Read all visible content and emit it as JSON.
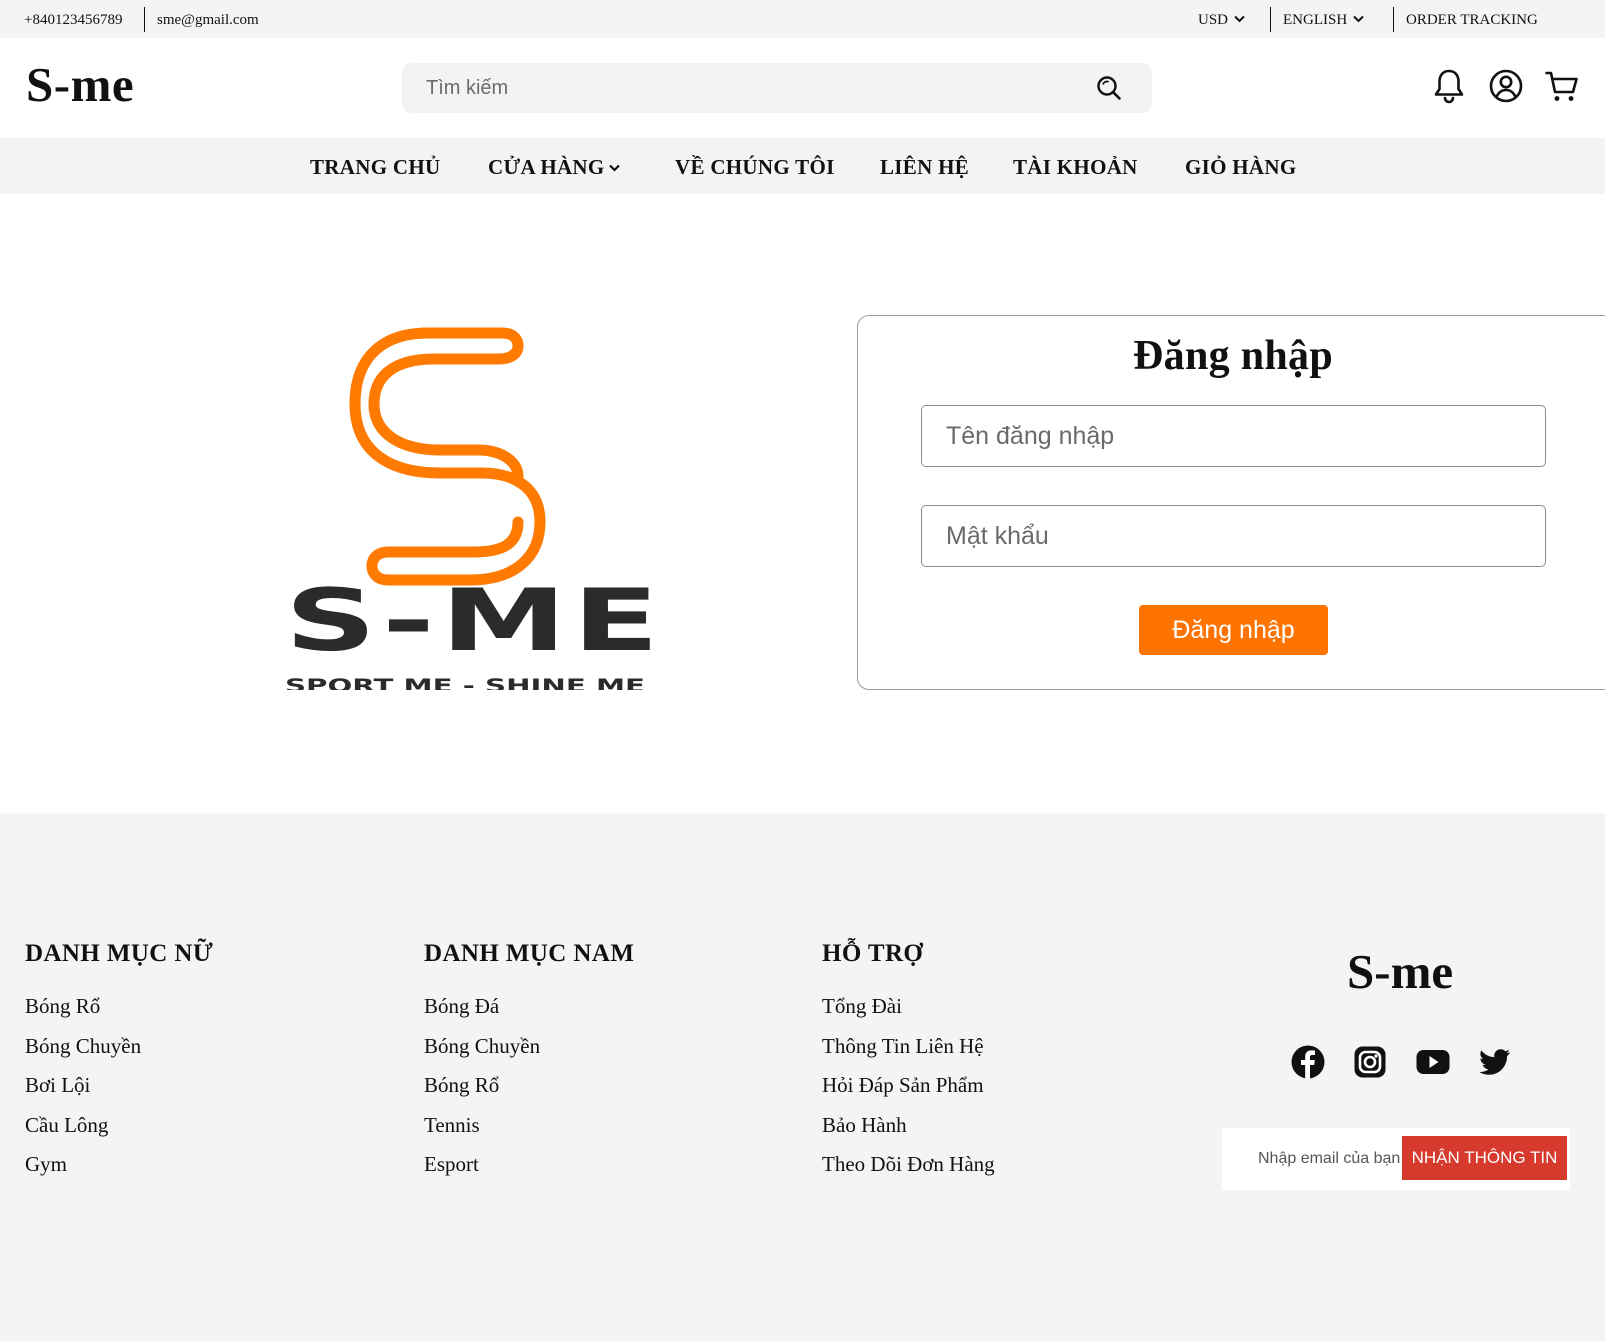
{
  "topbar": {
    "phone": "+840123456789",
    "email": "sme@gmail.com",
    "currency": "USD",
    "language": "ENGLISH",
    "order_tracking": "ORDER TRACKING"
  },
  "header": {
    "brand": "S-me",
    "search_placeholder": "Tìm kiếm",
    "icons": [
      "bell-icon",
      "user-icon",
      "cart-icon"
    ]
  },
  "nav": {
    "items": [
      "TRANG CHỦ",
      "CỬA HÀNG",
      "VỀ CHÚNG TÔI",
      "LIÊN HỆ",
      "TÀI KHOẢN",
      "GIỎ HÀNG"
    ]
  },
  "logo": {
    "wordmark": "S-ME",
    "tagline": "SPORT ME - SHINE ME",
    "accent_color": "#ff7a00"
  },
  "login": {
    "title": "Đăng nhập",
    "username_placeholder": "Tên đăng nhập",
    "password_placeholder": "Mật khẩu",
    "submit_label": "Đăng nhập",
    "button_color": "#ff7300"
  },
  "footer": {
    "women": {
      "title": "DANH MỤC NỮ",
      "items": [
        "Bóng Rổ",
        "Bóng Chuyền",
        "Bơi Lội",
        "Cầu Lông",
        "Gym"
      ]
    },
    "men": {
      "title": "DANH MỤC NAM",
      "items": [
        "Bóng Đá",
        "Bóng Chuyền",
        "Bóng Rổ",
        "Tennis",
        "Esport"
      ]
    },
    "support": {
      "title": "HỖ TRỢ",
      "items": [
        "Tổng Đài",
        "Thông Tin Liên Hệ",
        "Hỏi Đáp Sản Phẩm",
        "Bảo Hành",
        "Theo Dõi Đơn Hàng"
      ]
    },
    "brand": "S-me",
    "socials": [
      "facebook-icon",
      "instagram-icon",
      "youtube-icon",
      "twitter-icon"
    ],
    "newsletter_placeholder": "Nhập email của bạn",
    "newsletter_button": "NHẬN THÔNG TIN",
    "newsletter_button_color": "#d53a2d"
  }
}
